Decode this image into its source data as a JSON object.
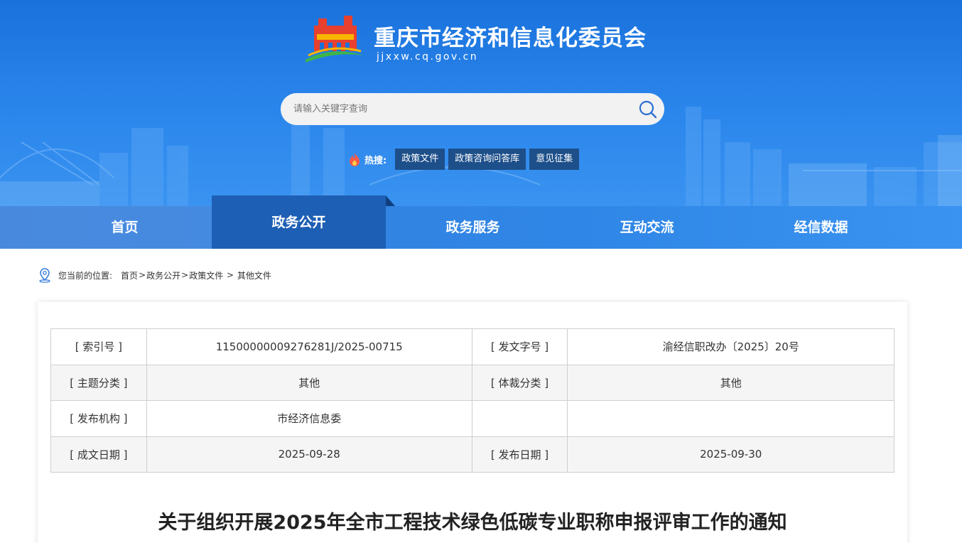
{
  "header": {
    "site_name": "重庆市经济和信息化委员会",
    "site_domain": "jjxxw.cq.gov.cn",
    "search_placeholder": "请输入关键字查询",
    "hot_label": "热搜:",
    "hot_tags": [
      "政策文件",
      "政策咨询问答库",
      "意见征集"
    ]
  },
  "nav": {
    "items": [
      "首页",
      "政务公开",
      "政务服务",
      "互动交流",
      "经信数据"
    ],
    "active": "政务公开"
  },
  "breadcrumb": {
    "prefix": "您当前的位置:",
    "items": [
      "首页",
      "政务公开",
      "政策文件",
      "其他文件"
    ],
    "separators": [
      ">",
      ">",
      " > "
    ]
  },
  "meta": {
    "rows": [
      [
        "[ 索引号 ]",
        "11500000009276281J/2025-00715",
        "[ 发文字号 ]",
        "渝经信职改办〔2025〕20号"
      ],
      [
        "[ 主题分类 ]",
        "其他",
        "[ 体裁分类 ]",
        "其他"
      ],
      [
        "[ 发布机构 ]",
        "市经济信息委",
        "",
        ""
      ],
      [
        "[ 成文日期 ]",
        "2025-09-28",
        "[ 发布日期 ]",
        "2025-09-30"
      ]
    ]
  },
  "document": {
    "title": "关于组织开展2025年全市工程技术绿色低碳专业职称申报评审工作的通知"
  },
  "colors": {
    "banner": "#2b86ec",
    "nav_active": "#1d5fb4",
    "hot_tag_bg": "#1d4f8a"
  }
}
